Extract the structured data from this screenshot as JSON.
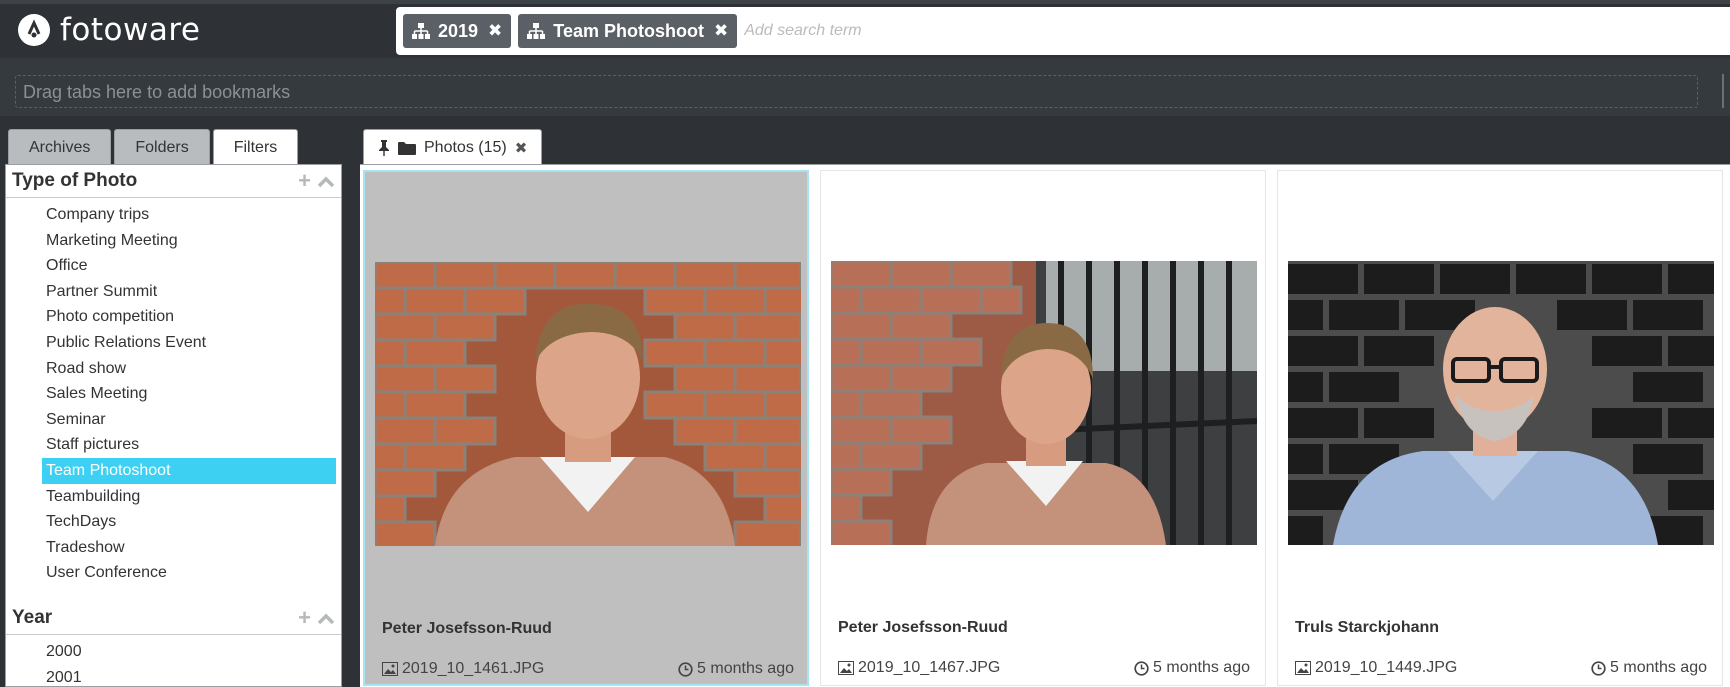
{
  "header": {
    "brand": "fotoware",
    "chips": [
      {
        "label": "2019",
        "icon": "hierarchy-icon"
      },
      {
        "label": "Team Photoshoot",
        "icon": "hierarchy-icon"
      }
    ],
    "search_placeholder": "Add search term"
  },
  "bookmarks": {
    "hint": "Drag tabs here to add bookmarks"
  },
  "left_tabs": [
    "Archives",
    "Folders",
    "Filters"
  ],
  "active_left_tab": "Filters",
  "filters": {
    "type_of_photo": {
      "title": "Type of Photo",
      "items": [
        "Company trips",
        "Marketing Meeting",
        "Office",
        "Partner Summit",
        "Photo competition",
        "Public Relations Event",
        "Road show",
        "Sales Meeting",
        "Seminar",
        "Staff pictures",
        "Team Photoshoot",
        "Teambuilding",
        "TechDays",
        "Tradeshow",
        "User Conference"
      ],
      "selected": "Team Photoshoot"
    },
    "year": {
      "title": "Year",
      "items": [
        "2000",
        "2001"
      ]
    }
  },
  "results_tab": {
    "label": "Photos (15)"
  },
  "cards": [
    {
      "name": "Peter Josefsson-Ruud",
      "file": "2019_10_1461.JPG",
      "age": "5 months ago",
      "selected": true
    },
    {
      "name": "Peter Josefsson-Ruud",
      "file": "2019_10_1467.JPG",
      "age": "5 months ago",
      "selected": false
    },
    {
      "name": "Truls Starckjohann",
      "file": "2019_10_1449.JPG",
      "age": "5 months ago",
      "selected": false
    }
  ],
  "colors": {
    "accent": "#3ed0f2",
    "topbar": "#2e3236",
    "chip": "#5a6066"
  }
}
